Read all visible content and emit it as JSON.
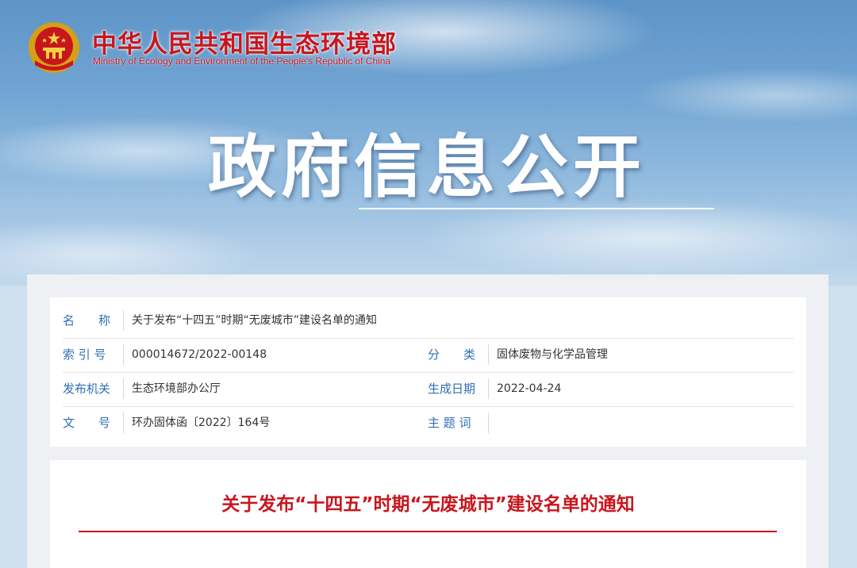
{
  "header": {
    "org_name_cn": "中华人民共和国生态环境部",
    "org_name_en": "Ministry of Ecology and Environment of the People's Republic of China",
    "emblem_icon": "national-emblem-icon"
  },
  "hero": {
    "title": "政府信息公开"
  },
  "meta": {
    "rows": [
      {
        "label": "名　　称",
        "value": "关于发布“十四五”时期“无废城市”建设名单的通知"
      },
      {
        "label": "索 引 号",
        "value": "000014672/2022-00148",
        "label2": "分　　类",
        "value2": "固体废物与化学品管理"
      },
      {
        "label": "发布机关",
        "value": "生态环境部办公厅",
        "label2": "生成日期",
        "value2": "2022-04-24"
      },
      {
        "label": "文　　号",
        "value": "环办固体函〔2022〕164号",
        "label2": "主 题 词",
        "value2": ""
      }
    ]
  },
  "document": {
    "title": "关于发布“十四五”时期“无废城市”建设名单的通知"
  },
  "colors": {
    "accent_red": "#c8161d",
    "label_blue": "#2f6fb6"
  }
}
